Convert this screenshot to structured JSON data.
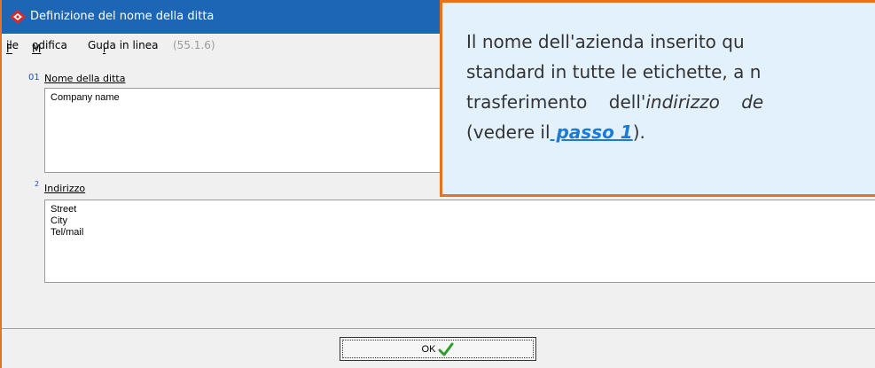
{
  "window": {
    "title": "Definizione del nome della ditta",
    "accent_color": "#1d66b5",
    "frame_color": "#e8731f",
    "app_icon": "red-diamond-icon"
  },
  "menu": {
    "file": "File",
    "modifica": "Modifica",
    "guida": "Guida in linea",
    "version": "(55.1.6)"
  },
  "fields": {
    "company": {
      "number": "01",
      "label": "Nome della ditta",
      "lines": [
        "Company name"
      ]
    },
    "address": {
      "number": "2",
      "label": "Indirizzo",
      "lines": [
        "Street",
        "City",
        "Tel/mail"
      ]
    }
  },
  "ok_button": {
    "label": "OK",
    "icon": "checkmark-icon"
  },
  "callout": {
    "line1": "Il nome dell'azienda inserito qu",
    "line2": "standard in tutte le etichette, a n",
    "line3_a": "trasferimento dell'",
    "line3_b": "indirizzo de",
    "line4_a": "(vedere il",
    "link": " passo 1",
    "line4_b": ")."
  }
}
